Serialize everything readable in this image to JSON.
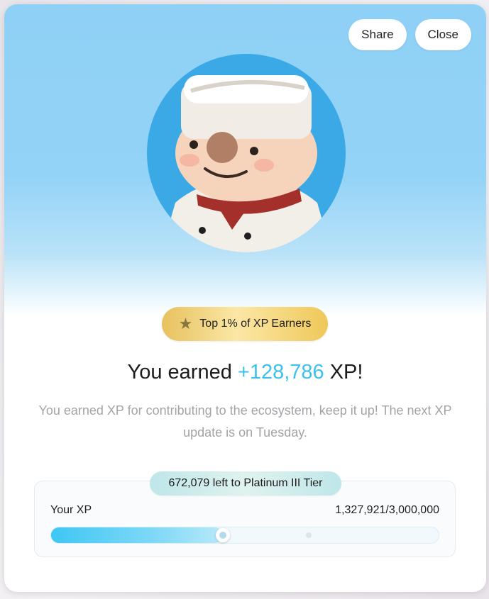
{
  "actions": {
    "share_label": "Share",
    "close_label": "Close"
  },
  "avatar": {
    "icon": "chef-avatar",
    "description": ""
  },
  "badge": {
    "icon": "star-icon",
    "label": "Top 1% of XP Earners"
  },
  "headline": {
    "prefix": "You earned ",
    "xp_amount": "+128,786",
    "suffix": " XP!"
  },
  "subtext": "You earned XP for contributing to the ecosystem, keep it up! The next XP update is on Tuesday.",
  "xp_panel": {
    "tier_remaining": "672,079 left to Platinum III Tier",
    "label": "Your XP",
    "value_text": "1,327,921/3,000,000",
    "current": 1327921,
    "target": 3000000,
    "next_tier_marker_fraction": 0.664
  },
  "colors": {
    "accent": "#3cc0ee",
    "hero_sky": "#8fd0f6",
    "badge_gold": "#efc85a",
    "chip_teal": "#bfe6e9"
  }
}
